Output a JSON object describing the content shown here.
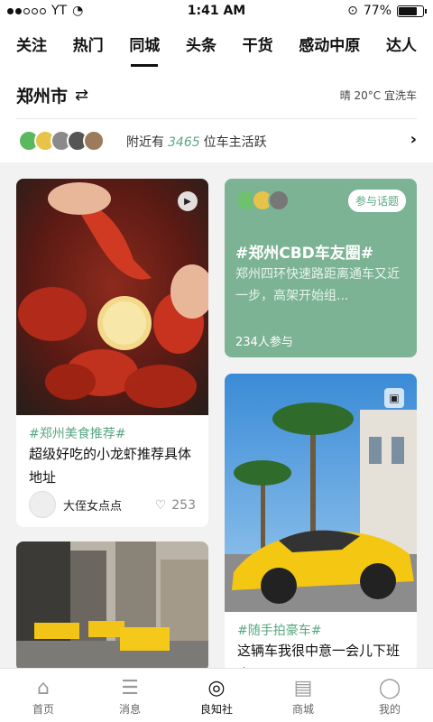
{
  "status_bar": {
    "carrier": "YT",
    "time": "1:41 AM",
    "battery": "77%",
    "battery_level": 0.77
  },
  "tabs": [
    {
      "label": "关注"
    },
    {
      "label": "热门"
    },
    {
      "label": "同城",
      "active": true
    },
    {
      "label": "头条"
    },
    {
      "label": "干货"
    },
    {
      "label": "感动中原"
    },
    {
      "label": "达人"
    }
  ],
  "location": {
    "city": "郑州市",
    "swap_icon": "swap-arrows-icon",
    "weather": "晴 20°C 宜洗车"
  },
  "nearby": {
    "prefix": "附近有",
    "count": "3465",
    "suffix": "位车主活跃"
  },
  "posts": [
    {
      "tag": "#郑州美食推荐#",
      "title": "超级好吃的小龙虾推荐具体地址",
      "author": "大侄女点点",
      "likes": "253",
      "media_icon": "play-icon"
    },
    {
      "tag": "#随手拍豪车#",
      "title": "这辆车我很中意一会儿下班去买买",
      "media_icon": "gallery-icon"
    }
  ],
  "topic": {
    "join_label": "参与话题",
    "title": "#郑州CBD车友圈#",
    "desc": "郑州四环快速路距离通车又近一步，高架开始组...",
    "participants": "234人参与"
  },
  "bottom_nav": [
    {
      "label": "首页",
      "icon": "home-icon"
    },
    {
      "label": "消息",
      "icon": "message-icon"
    },
    {
      "label": "良知社",
      "icon": "planet-icon",
      "active": true
    },
    {
      "label": "商城",
      "icon": "shop-icon"
    },
    {
      "label": "我的",
      "icon": "profile-icon"
    }
  ],
  "colors": {
    "accent": "#5aa781",
    "topic_bg": "#7cb394"
  }
}
